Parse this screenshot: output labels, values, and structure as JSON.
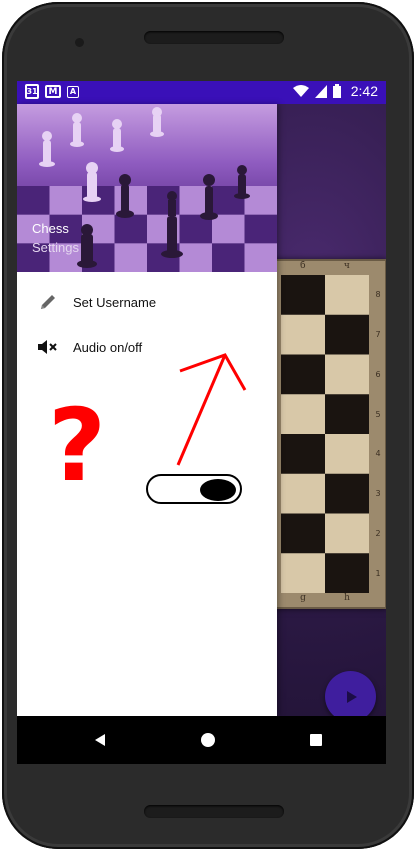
{
  "status_bar": {
    "time": "2:42",
    "icons": [
      "calendar-icon",
      "gmail-icon",
      "a-icon",
      "wifi-icon",
      "signal-icon",
      "battery-icon"
    ],
    "calendar_day": "31",
    "a_label": "A",
    "gmail_label": "M",
    "color": "#3a10b8"
  },
  "drawer": {
    "header": {
      "title": "Chess",
      "subtitle": "Settings"
    },
    "items": [
      {
        "label": "Set Username",
        "icon": "pencil-icon"
      },
      {
        "label": "Audio on/off",
        "icon": "volume-mute-icon"
      }
    ]
  },
  "background": {
    "board_files_top": [
      "б",
      "ч"
    ],
    "board_files_bottom": [
      "g",
      "h"
    ],
    "board_ranks": [
      "8",
      "7",
      "6",
      "5",
      "4",
      "3",
      "2",
      "1"
    ],
    "fab_icon": "play-icon"
  },
  "annotations": {
    "question_mark": "?",
    "toggle_state": "on",
    "arrow_color": "#ff0000"
  },
  "nav_bar": {
    "buttons": [
      "back-icon",
      "home-icon",
      "recents-icon"
    ]
  }
}
